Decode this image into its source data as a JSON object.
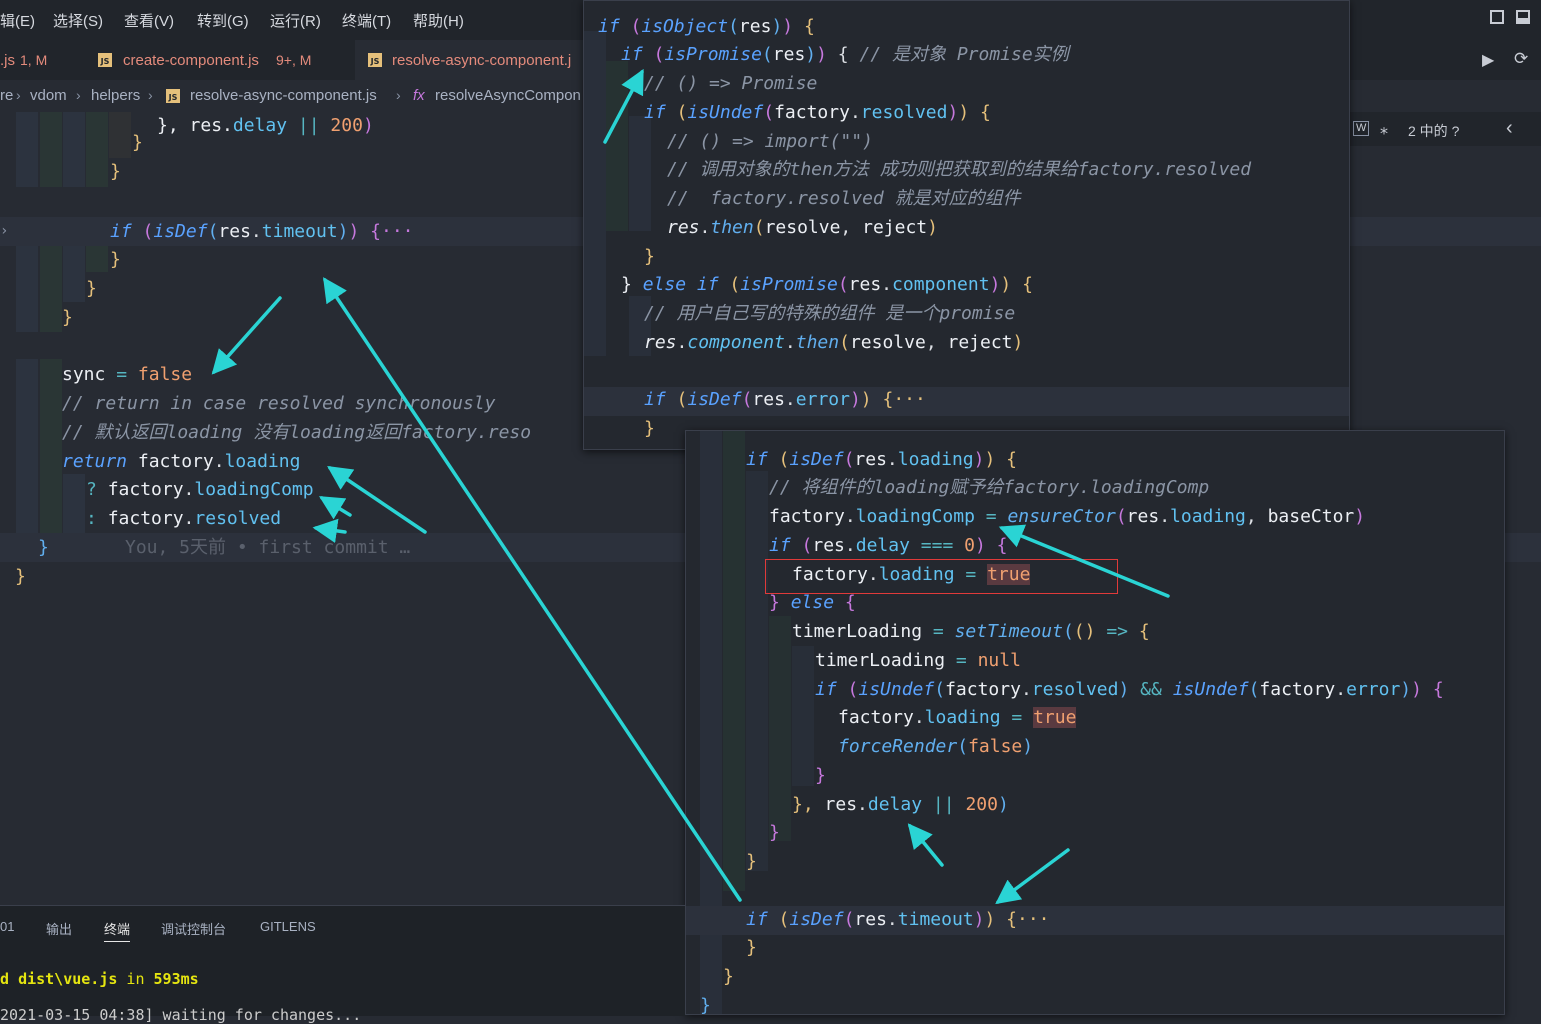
{
  "menubar": {
    "items": [
      "辑(E)",
      "选择(S)",
      "查看(V)",
      "转到(G)",
      "运行(R)",
      "终端(T)",
      "帮助(H)"
    ]
  },
  "tabs": [
    {
      "name": ".js",
      "status": "1, M"
    },
    {
      "name": "create-component.js",
      "status": "9+, M"
    },
    {
      "name": "resolve-async-component.j",
      "status": ""
    }
  ],
  "breadcrumb": {
    "items": [
      "re",
      "vdom",
      "helpers",
      "resolve-async-component.js",
      "resolveAsyncCompon"
    ],
    "js_badge": "JS",
    "fx_symbol": "fx"
  },
  "findbar": {
    "result": "2 中的 ?"
  },
  "left_editor": {
    "line1": [
      "}, ",
      "res",
      ".",
      "delay",
      " || ",
      "200",
      ")"
    ],
    "if_timeout": [
      "if",
      "isDef",
      "res",
      "timeout",
      "{···"
    ],
    "sync_line": [
      "sync",
      "false"
    ],
    "comment1": "// return in case resolved synchronously",
    "comment2": "// 默认返回loading 没有loading返回factory.reso",
    "return_line": [
      "return",
      "factory",
      "loading"
    ],
    "ternary1": [
      "?",
      "factory",
      "loadingComp"
    ],
    "ternary2": [
      ":",
      "factory",
      "resolved"
    ],
    "blame": "You, 5天前 • first commit …"
  },
  "popup_top": {
    "l1": [
      "if",
      "isObject",
      "res"
    ],
    "l2": [
      "if",
      "isPromise",
      "res",
      "// 是对象 Promise实例"
    ],
    "l3": "// () => Promise",
    "l4": [
      "if",
      "isUndef",
      "factory",
      "resolved"
    ],
    "l5": "// () => import(\"\")",
    "l6": "// 调用对象的then方法 成功则把获取到的结果给factory.resolved",
    "l7": "//  factory.resolved 就是对应的组件",
    "l8": [
      "res",
      "then",
      "resolve",
      "reject"
    ],
    "l10": [
      "} ",
      "else",
      "if",
      "isPromise",
      "res",
      "component"
    ],
    "l11": "// 用户自己写的特殊的组件 是一个promise",
    "l12": [
      "res",
      "component",
      "then",
      "resolve",
      "reject"
    ],
    "l14": [
      "if",
      "isDef",
      "res",
      "error",
      "{···"
    ]
  },
  "popup_bottom": {
    "l1": [
      "if",
      "isDef",
      "res",
      "loading"
    ],
    "l2": "// 将组件的loading赋予给factory.loadingComp",
    "l3": [
      "factory",
      "loadingComp",
      "ensureCtor",
      "res",
      "loading",
      "baseCtor"
    ],
    "l4": [
      "if",
      "res",
      "delay",
      "===",
      "0"
    ],
    "l5": [
      "factory",
      "loading",
      "true"
    ],
    "l6": [
      "} ",
      "else"
    ],
    "l7": [
      "timerLoading",
      "setTimeout",
      "=>"
    ],
    "l8": [
      "timerLoading",
      "null"
    ],
    "l9": [
      "if",
      "isUndef",
      "factory",
      "resolved",
      "&&",
      "isUndef",
      "factory",
      "error"
    ],
    "l10": [
      "factory",
      "loading",
      "true"
    ],
    "l11": [
      "forceRender",
      "false"
    ],
    "l13": [
      "}, ",
      "res",
      "delay",
      "||",
      "200"
    ],
    "l16": [
      "if",
      "isDef",
      "res",
      "timeout",
      "{···"
    ]
  },
  "panel": {
    "tabs": [
      "01",
      "输出",
      "终端",
      "调试控制台",
      "GITLENS"
    ],
    "active_tab": "终端",
    "terminal_line1_prefix": "d ",
    "terminal_line1_file": "dist\\vue.js",
    "terminal_line1_mid": " in ",
    "terminal_line1_time": "593ms",
    "terminal_line2": "2021-03-15 04:38] waiting for changes..."
  },
  "colors": {
    "editor_bg": "#272b33",
    "keyword": "#5aa2ff",
    "property": "#61c1f0",
    "number": "#f0a070",
    "comment": "#8b95a5",
    "annotation_arrow": "#2ad4d4",
    "highlight_box": "#e03a3a",
    "tab_modified": "#e48b7c"
  }
}
